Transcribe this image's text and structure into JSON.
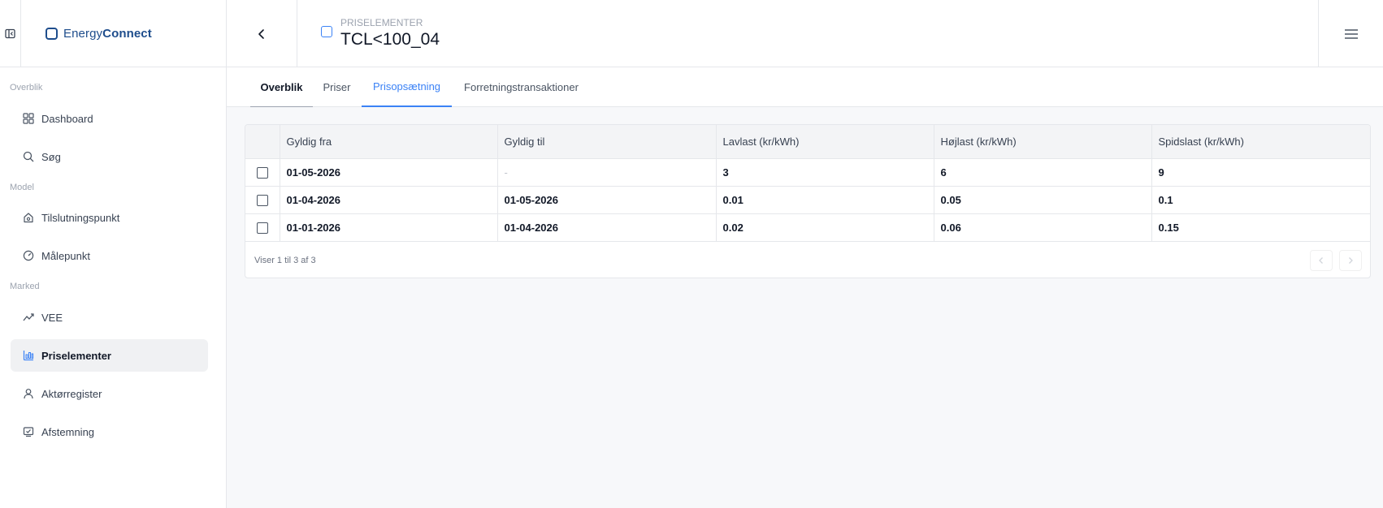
{
  "header": {
    "brand_prefix": "Energy",
    "brand_suffix": "Connect",
    "breadcrumb": "PRISELEMENTER",
    "title": "TCL<100_04"
  },
  "sidebar": {
    "sections": [
      {
        "label": "Overblik"
      },
      {
        "label": "Model"
      },
      {
        "label": "Marked"
      }
    ],
    "items": [
      {
        "label": "Dashboard",
        "icon": "grid-icon"
      },
      {
        "label": "Søg",
        "icon": "search-icon"
      },
      {
        "label": "Tilslutningspunkt",
        "icon": "house-icon"
      },
      {
        "label": "Målepunkt",
        "icon": "gauge-icon"
      },
      {
        "label": "VEE",
        "icon": "trend-icon"
      },
      {
        "label": "Priselementer",
        "icon": "price-chart-icon",
        "active": true
      },
      {
        "label": "Aktørregister",
        "icon": "user-icon"
      },
      {
        "label": "Afstemning",
        "icon": "reconcile-icon"
      }
    ]
  },
  "tabs": [
    {
      "label": "Overblik"
    },
    {
      "label": "Priser"
    },
    {
      "label": "Prisopsætning",
      "active": true
    },
    {
      "label": "Forretningstransaktioner"
    }
  ],
  "table": {
    "columns": [
      "Gyldig fra",
      "Gyldig til",
      "Lavlast (kr/kWh)",
      "Højlast (kr/kWh)",
      "Spidslast (kr/kWh)"
    ],
    "rows": [
      [
        "01-05-2026",
        "-",
        "3",
        "6",
        "9"
      ],
      [
        "01-04-2026",
        "01-05-2026",
        "0.01",
        "0.05",
        "0.1"
      ],
      [
        "01-01-2026",
        "01-04-2026",
        "0.02",
        "0.06",
        "0.15"
      ]
    ],
    "footer": "Viser 1 til 3 af 3"
  },
  "colors": {
    "brand": "#1e4d8c",
    "accent": "#3b82f6"
  }
}
